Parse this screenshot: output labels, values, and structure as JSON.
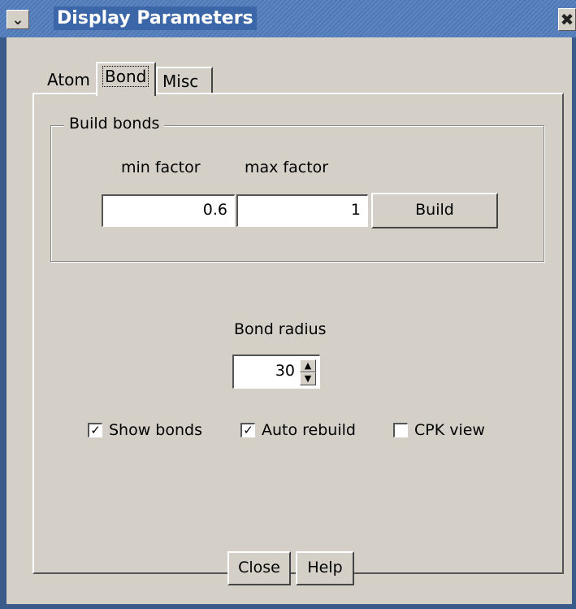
{
  "window": {
    "title": "Display Parameters",
    "menu_icon": "chevron-down-icon",
    "close_icon": "close-icon"
  },
  "tabs": [
    {
      "label": "Atom",
      "active": false
    },
    {
      "label": "Bond",
      "active": true
    },
    {
      "label": "Misc",
      "active": false
    }
  ],
  "build_bonds": {
    "title": "Build bonds",
    "min_label": "min factor",
    "max_label": "max factor",
    "min_value": "0.6",
    "max_value": "1",
    "build_label": "Build"
  },
  "bond_radius": {
    "label": "Bond radius",
    "value": "30"
  },
  "options": [
    {
      "label": "Show bonds",
      "checked": true
    },
    {
      "label": "Auto rebuild",
      "checked": true
    },
    {
      "label": "CPK view",
      "checked": false
    }
  ],
  "footer": {
    "close_label": "Close",
    "help_label": "Help"
  },
  "colors": {
    "titlebar": "#4f79b4",
    "background": "#d4d0c8"
  }
}
